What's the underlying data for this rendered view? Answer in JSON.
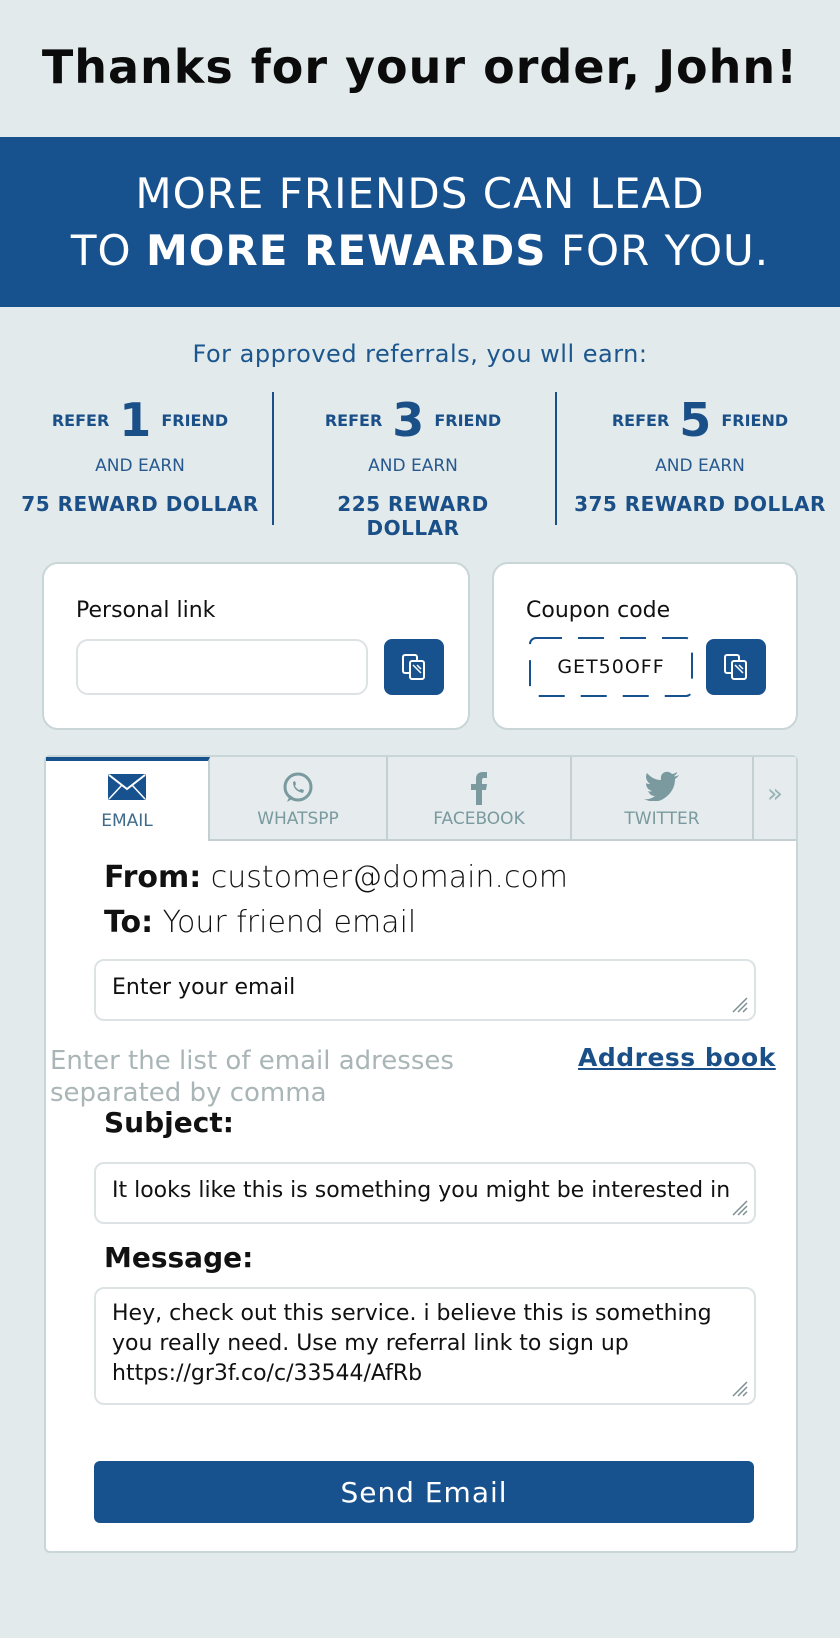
{
  "header": {
    "title": "Thanks for your order, John!"
  },
  "banner": {
    "line1": "MORE FRIENDS CAN LEAD",
    "line2_prefix": "TO ",
    "line2_bold": "MORE REWARDS",
    "line2_suffix": " FOR YOU."
  },
  "rewards": {
    "intro": "For approved referrals, you wll earn:",
    "tiers": [
      {
        "refer": "REFER",
        "count": "1",
        "friend": "FRIEND",
        "and_earn": "AND EARN",
        "amount": "75 REWARD DOLLAR"
      },
      {
        "refer": "REFER",
        "count": "3",
        "friend": "FRIEND",
        "and_earn": "AND EARN",
        "amount": "225 REWARD DOLLAR"
      },
      {
        "refer": "REFER",
        "count": "5",
        "friend": "FRIEND",
        "and_earn": "AND EARN",
        "amount": "375 REWARD DOLLAR"
      }
    ]
  },
  "personal_link": {
    "label": "Personal link",
    "value": ""
  },
  "coupon": {
    "label": "Coupon code",
    "code": "GET50OFF"
  },
  "tabs": [
    {
      "label": "EMAIL",
      "icon": "envelope-icon",
      "active": true
    },
    {
      "label": "WHATSPP",
      "icon": "whatsapp-icon",
      "active": false
    },
    {
      "label": "FACEBOOK",
      "icon": "facebook-icon",
      "active": false
    },
    {
      "label": "TWITTER",
      "icon": "twitter-icon",
      "active": false
    },
    {
      "label": "»",
      "icon": "chevron-double-right-icon",
      "active": false
    }
  ],
  "email_form": {
    "from_label": "From:",
    "from_value": "customer@domain.com",
    "to_label": "To:",
    "to_value": "Your friend email",
    "email_input_value": "Enter your email",
    "hint": "Enter the list of email adresses separated by comma",
    "address_book": "Address book",
    "subject_label": "Subject:",
    "subject_value": "It looks like this is something you might be interested in",
    "message_label": "Message:",
    "message_value": "Hey, check out this service. i believe this is something you really need. Use my referral link to sign up https://gr3f.co/c/33544/AfRb",
    "send_label": "Send Email"
  },
  "colors": {
    "brand": "#17528f",
    "background": "#e2eaeb",
    "muted_text": "#a9b5b7",
    "tab_inactive": "#7a9a9f"
  }
}
